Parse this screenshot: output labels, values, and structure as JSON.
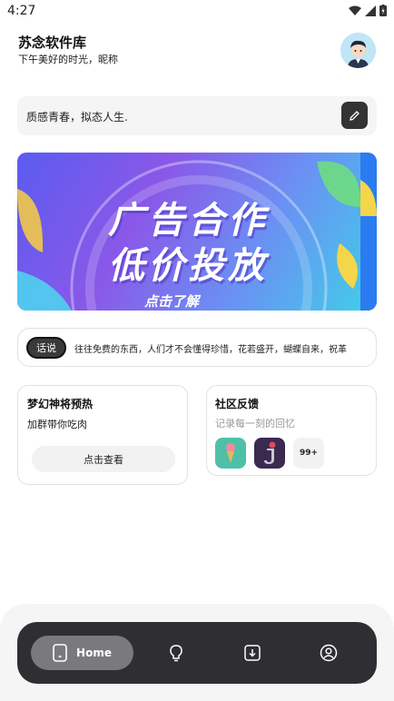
{
  "status": {
    "time": "4:27"
  },
  "header": {
    "app_title": "苏念软件库",
    "greeting": "下午美好的时光，昵称"
  },
  "signature": {
    "text": "质感青春，拟态人生."
  },
  "banner": {
    "line1": "广告合作",
    "line2": "低价投放",
    "cta": "点击了解"
  },
  "talk": {
    "badge": "话说",
    "text": "往往免费的东西，人们才不会懂得珍惜，花若盛开，蝴蝶自来，祝革"
  },
  "card_promo": {
    "title": "梦幻神将预热",
    "subtitle": "加群带你吃肉",
    "button": "点击查看"
  },
  "card_feedback": {
    "title": "社区反馈",
    "subtitle": "记录每一刻的回忆",
    "count": "99+"
  },
  "nav": {
    "home_label": "Home",
    "items": [
      "home-icon",
      "bulb-icon",
      "download-icon",
      "user-icon"
    ]
  },
  "colors": {
    "nav_bg": "#2f2f33",
    "nav_active": "#7a7a7e",
    "banner_accent": "#8a58e8"
  }
}
